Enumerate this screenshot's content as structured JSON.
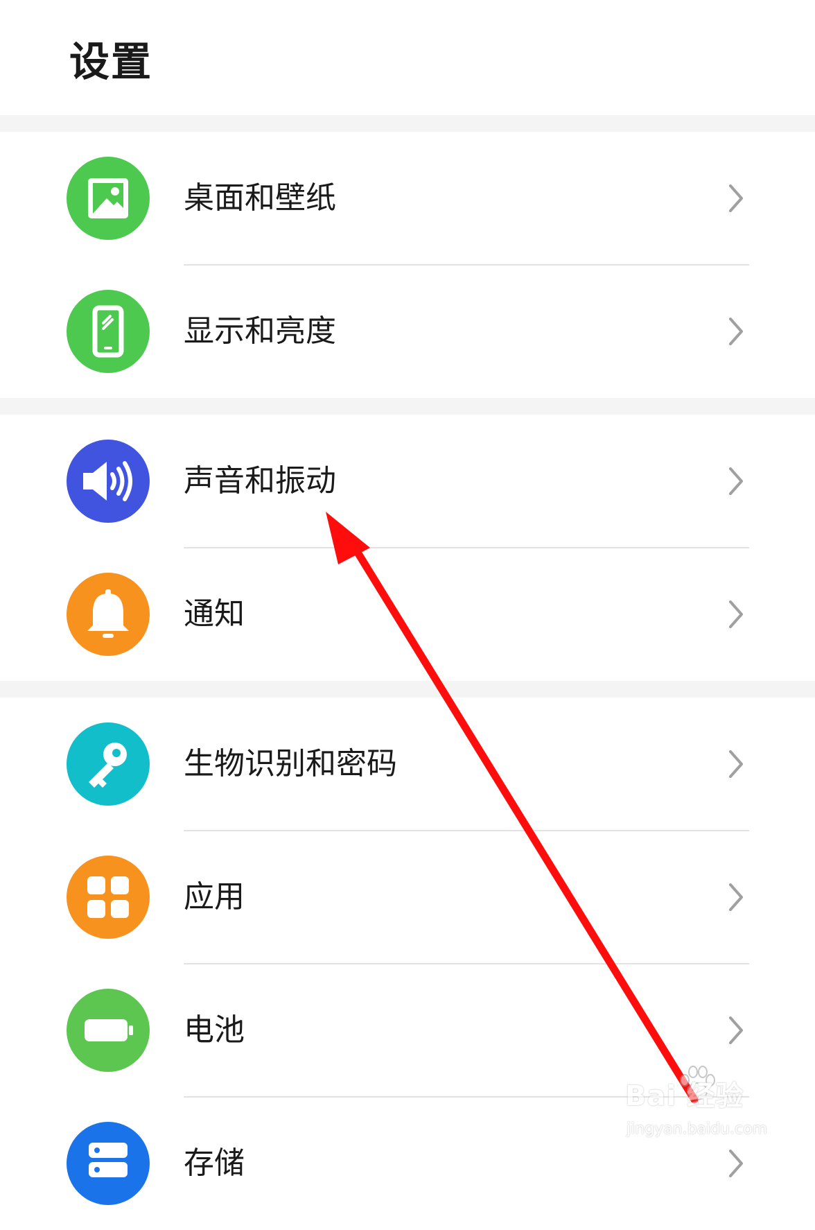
{
  "page": {
    "title": "设置"
  },
  "settings": {
    "items": [
      {
        "label": "桌面和壁纸",
        "icon": "wallpaper-icon",
        "color": "#4cc94e"
      },
      {
        "label": "显示和亮度",
        "icon": "phone-display-icon",
        "color": "#4cc94e"
      },
      {
        "label": "声音和振动",
        "icon": "speaker-icon",
        "color": "#4054e0"
      },
      {
        "label": "通知",
        "icon": "bell-icon",
        "color": "#f7921e"
      },
      {
        "label": "生物识别和密码",
        "icon": "key-icon",
        "color": "#11bec9"
      },
      {
        "label": "应用",
        "icon": "apps-grid-icon",
        "color": "#f7921e"
      },
      {
        "label": "电池",
        "icon": "battery-icon",
        "color": "#5cc650"
      },
      {
        "label": "存储",
        "icon": "storage-icon",
        "color": "#1a73e8"
      }
    ]
  },
  "annotation": {
    "arrow_color": "#ff0d0d"
  },
  "watermark": {
    "brand": "Bai 经验",
    "url": "jingyan.baidu.com"
  }
}
